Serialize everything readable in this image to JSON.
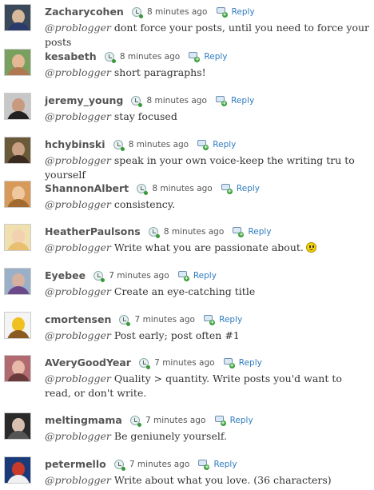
{
  "feed": {
    "tweets": [
      {
        "username": "Zacharycohen",
        "time": "8 minutes ago",
        "reply": "Reply",
        "mention": "@problogger",
        "text": " dont force your posts, until you need to force your posts",
        "avatar_colors": [
          "#3a4a5a",
          "#d8b89a",
          "#2a3a6a"
        ]
      },
      {
        "username": "kesabeth",
        "time": "8 minutes ago",
        "reply": "Reply",
        "mention": "@problogger",
        "text": " short paragraphs!",
        "avatar_colors": [
          "#7aa060",
          "#e4b894",
          "#b07850"
        ]
      },
      {
        "username": "jeremy_young",
        "time": "8 minutes ago",
        "reply": "Reply",
        "mention": "@problogger",
        "text": " stay focused",
        "avatar_colors": [
          "#c8c8c8",
          "#c89a80",
          "#222222"
        ]
      },
      {
        "username": "hchybinski",
        "time": "8 minutes ago",
        "reply": "Reply",
        "mention": "@problogger",
        "text": " speak in your own voice-keep the writing tru to yourself",
        "avatar_colors": [
          "#6a5a3a",
          "#caa084",
          "#3a2a20"
        ]
      },
      {
        "username": "ShannonAlbert",
        "time": "8 minutes ago",
        "reply": "Reply",
        "mention": "@problogger",
        "text": " consistency.",
        "avatar_colors": [
          "#d89a5a",
          "#f0c8a0",
          "#a06a30"
        ]
      },
      {
        "username": "HeatherPaulsons",
        "time": "8 minutes ago",
        "reply": "Reply",
        "mention": "@problogger",
        "text": " Write what you are passionate about.",
        "smiley": true,
        "avatar_colors": [
          "#f0e0b0",
          "#f2d0b0",
          "#e8c070"
        ]
      },
      {
        "username": "Eyebee",
        "time": "7 minutes ago",
        "reply": "Reply",
        "mention": "@problogger",
        "text": " Create an eye-catching title",
        "avatar_colors": [
          "#9ab0c8",
          "#d8b0a0",
          "#6a4a8a"
        ]
      },
      {
        "username": "cmortensen",
        "time": "7 minutes ago",
        "reply": "Reply",
        "mention": "@problogger",
        "text": " Post early; post often #1",
        "avatar_colors": [
          "#f4f4f4",
          "#f0c020",
          "#8a5a20"
        ]
      },
      {
        "username": "AVeryGoodYear",
        "time": "7 minutes ago",
        "reply": "Reply",
        "mention": "@problogger",
        "text": " Quality > quantity. Write posts you'd want to read, or don't write.",
        "avatar_colors": [
          "#b06a70",
          "#e8b8a8",
          "#6a3a3a"
        ]
      },
      {
        "username": "meltingmama",
        "time": "7 minutes ago",
        "reply": "Reply",
        "mention": "@problogger",
        "text": " Be geniunely yourself.",
        "avatar_colors": [
          "#2a2a2a",
          "#d8c0b0",
          "#555555"
        ]
      },
      {
        "username": "petermello",
        "time": "7 minutes ago",
        "reply": "Reply",
        "mention": "@problogger",
        "text": " Write about what you love. (36 characters)",
        "avatar_colors": [
          "#1a3a7a",
          "#c83a2a",
          "#f0f0f0"
        ]
      }
    ]
  },
  "icons": {
    "time": "clock-icon",
    "reply": "reply-icon",
    "smiley": "smiley-emoticon-icon"
  },
  "colors": {
    "username": "#555555",
    "reply_link": "#2e7bbf",
    "text": "#333333"
  }
}
